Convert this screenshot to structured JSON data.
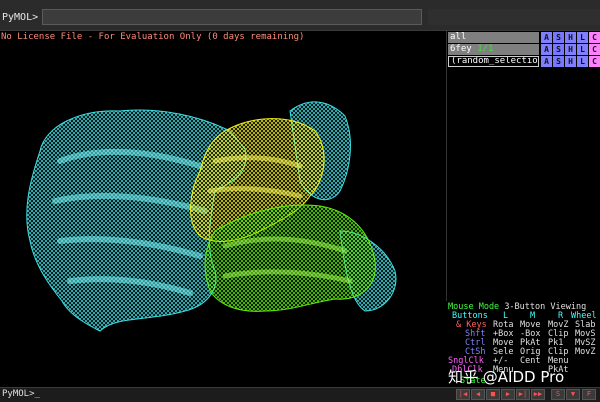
{
  "command_bar": {
    "prompt": "PyMOL>"
  },
  "viewer": {
    "license_text": "No License File - For Evaluation Only (0 days remaining)",
    "colors": {
      "chain_a": "#3ee0e6",
      "chain_b": "#f3f01a",
      "chain_c": "#5ef010"
    }
  },
  "objects": [
    {
      "name": "all",
      "frames": "",
      "buttons": [
        "A",
        "S",
        "H",
        "L",
        "C"
      ]
    },
    {
      "name": "6fey",
      "frames": "1/1",
      "buttons": [
        "A",
        "S",
        "H",
        "L",
        "C"
      ]
    },
    {
      "name": "(random_selectio",
      "frames": "",
      "buttons": [
        "A",
        "S",
        "H",
        "L",
        "C"
      ]
    }
  ],
  "mouse_mode": {
    "title": "Mouse Mode",
    "mode": "3-Button Viewing",
    "header": {
      "buttons": "Buttons",
      "l": "L",
      "m": "M",
      "r": "R",
      "wheel": "Wheel"
    },
    "rows": [
      {
        "key": "& Keys",
        "l": "Rota",
        "m": "Move",
        "r": "MovZ",
        "w": "Slab"
      },
      {
        "key": "Shft",
        "l": "+Box",
        "m": "-Box",
        "r": "Clip",
        "w": "MovS"
      },
      {
        "key": "Ctrl",
        "l": "Move",
        "m": "PkAt",
        "r": "Pk1",
        "w": "MvSZ"
      },
      {
        "key": "CtSh",
        "l": "Sele",
        "m": "Orig",
        "r": "Clip",
        "w": "MovZ"
      },
      {
        "key": "SnglClk",
        "l": "+/-",
        "m": "Cent",
        "r": "Menu",
        "w": ""
      },
      {
        "key": "DblClk",
        "l": "Menu",
        "m": "",
        "r": "PkAt",
        "w": ""
      }
    ],
    "footer": "State"
  },
  "watermark": "知乎 @AIDD Pro",
  "bottom_bar": {
    "prompt": "PyMOL>_",
    "movie_buttons": [
      "|◀",
      "◀",
      "■",
      "▶",
      "▶|",
      "▶▶",
      "S",
      "▼",
      "F"
    ]
  }
}
